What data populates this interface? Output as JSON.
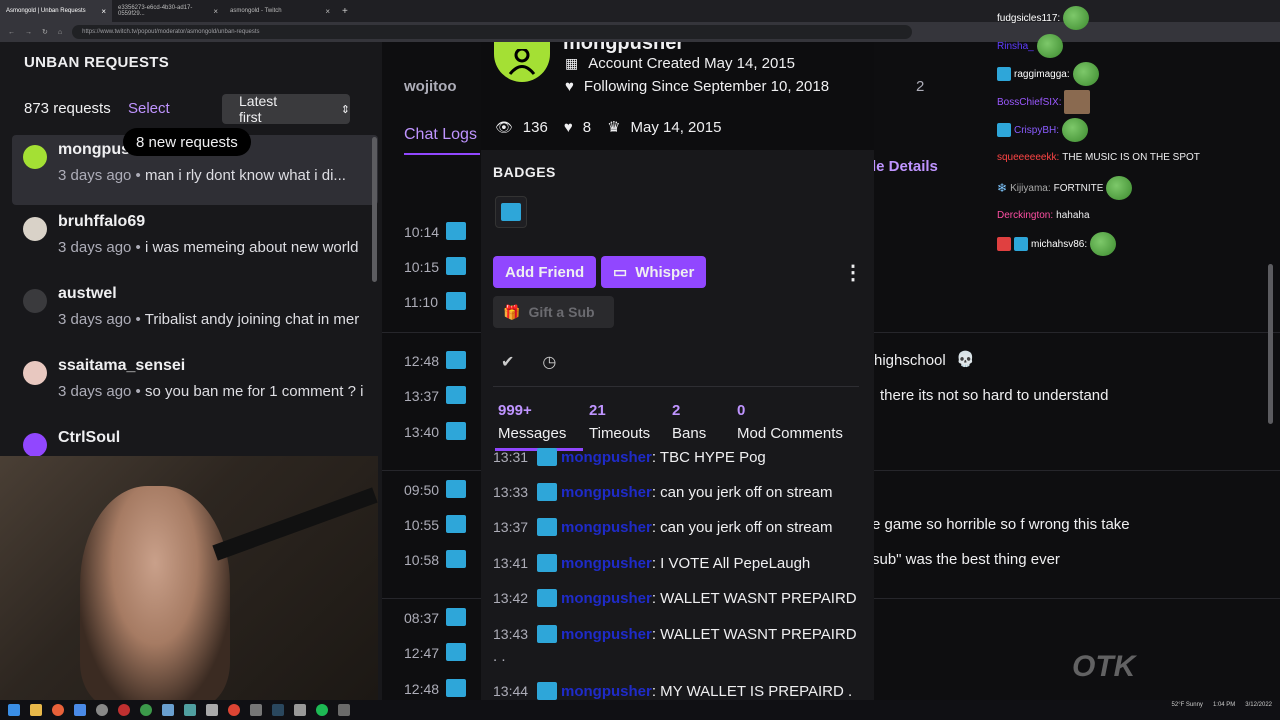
{
  "browser": {
    "tabs": [
      {
        "label": "Asmongold | Unban Requests",
        "active": true
      },
      {
        "label": "e3356273-e6cd-4b30-ad17-0559f29...",
        "active": false
      },
      {
        "label": "asmongold - Twitch",
        "active": false
      }
    ],
    "url": "https://www.twitch.tv/popout/moderator/asmongold/unban-requests"
  },
  "left": {
    "title": "UNBAN REQUESTS",
    "count": "873 requests",
    "select_label": "Select",
    "sort_label": "Latest first",
    "toast": "8 new requests",
    "requests": [
      {
        "name": "mongpusher",
        "time": "3 days ago",
        "message": "man i rly dont know what i di...",
        "avatar_color": "#a4e034"
      },
      {
        "name": "bruhffalo69",
        "time": "3 days ago",
        "message": "i was memeing about new world",
        "avatar_color": "#d9d2c8"
      },
      {
        "name": "austwel",
        "time": "3 days ago",
        "message": "Tribalist andy joining chat in mer",
        "avatar_color": "#3a3a3d"
      },
      {
        "name": "ssaitama_sensei",
        "time": "3 days ago",
        "message": "so you ban me for 1 comment ? i",
        "avatar_color": "#e8c8c0"
      },
      {
        "name": "CtrlSoul",
        "time": "",
        "message": "",
        "avatar_color": "#9147ff"
      }
    ]
  },
  "middle": {
    "header_user": "wojitoo",
    "header_num": "2",
    "chat_logs_tab": "Chat Logs",
    "details_link": "le Details",
    "rows": [
      {
        "time": "10:14",
        "text": ""
      },
      {
        "time": "10:15",
        "text": ""
      },
      {
        "time": "11:10",
        "text": ""
      },
      {
        "time": "12:48",
        "text": "highschool"
      },
      {
        "time": "13:37",
        "text": "there its not so hard to understand"
      },
      {
        "time": "13:40",
        "text": ""
      },
      {
        "time": "09:50",
        "text": ""
      },
      {
        "time": "10:55",
        "text": "e game so horrible so f wrong this take"
      },
      {
        "time": "10:58",
        "text": "sub\" was the best thing ever"
      },
      {
        "time": "08:37",
        "text": ""
      },
      {
        "time": "12:47",
        "text": ""
      },
      {
        "time": "12:48",
        "text": ""
      }
    ]
  },
  "chat_overlay": [
    {
      "user": "fudgsicles117:",
      "msg": "",
      "color": "#ffffff"
    },
    {
      "user": "Rinsha_",
      "msg": "",
      "color": "#5f3dff"
    },
    {
      "user": "raggimagga:",
      "msg": "",
      "color": "#ffffff"
    },
    {
      "user": "BossChiefSIX:",
      "msg": "",
      "color": "#9b59ff"
    },
    {
      "user": "CrispyBH:",
      "msg": "",
      "color": "#8a5cff"
    },
    {
      "user": "squeeeeeekk:",
      "msg": "THE MUSIC IS ON THE SPOT",
      "color": "#ff4545"
    },
    {
      "user": "Kijiyama:",
      "msg": "FORTNITE",
      "color": "#aaaaaa"
    },
    {
      "user": "Derckington:",
      "msg": "hahaha",
      "color": "#ff4fa3"
    },
    {
      "user": "michahsv86:",
      "msg": "",
      "color": "#ffffff"
    }
  ],
  "card": {
    "username": "mongpusher",
    "created": "Account Created May 14, 2015",
    "following": "Following Since September 10, 2018",
    "views": "136",
    "followers": "8",
    "since": "May 14, 2015",
    "badges_title": "BADGES",
    "add_friend": "Add Friend",
    "whisper": "Whisper",
    "gift": "Gift a Sub",
    "stats": [
      {
        "num": "999+",
        "label": "Messages"
      },
      {
        "num": "21",
        "label": "Timeouts"
      },
      {
        "num": "2",
        "label": "Bans"
      },
      {
        "num": "0",
        "label": "Mod Comments"
      }
    ],
    "messages": [
      {
        "time": "13:31",
        "text": ": TBC HYPE Pog"
      },
      {
        "time": "13:33",
        "text": ": can you jerk off on stream"
      },
      {
        "time": "13:37",
        "text": ": can you jerk off on stream"
      },
      {
        "time": "13:41",
        "text": ": I VOTE All PepeLaugh"
      },
      {
        "time": "13:42",
        "text": ": WALLET WASNT PREPAIRD"
      },
      {
        "time": "13:43",
        "text": ": WALLET WASNT PREPAIRD"
      },
      {
        "time": "13:44",
        "text": ": MY WALLET IS PREPAIRD ."
      }
    ],
    "dots": ". ."
  },
  "tray": {
    "weather": "52°F  Sunny",
    "time": "1:04 PM",
    "date": "3/12/2022"
  },
  "watermark": "OTK",
  "colors": {
    "accent": "#9147ff",
    "link": "#bf94ff",
    "badge": "#2ea6d9"
  }
}
